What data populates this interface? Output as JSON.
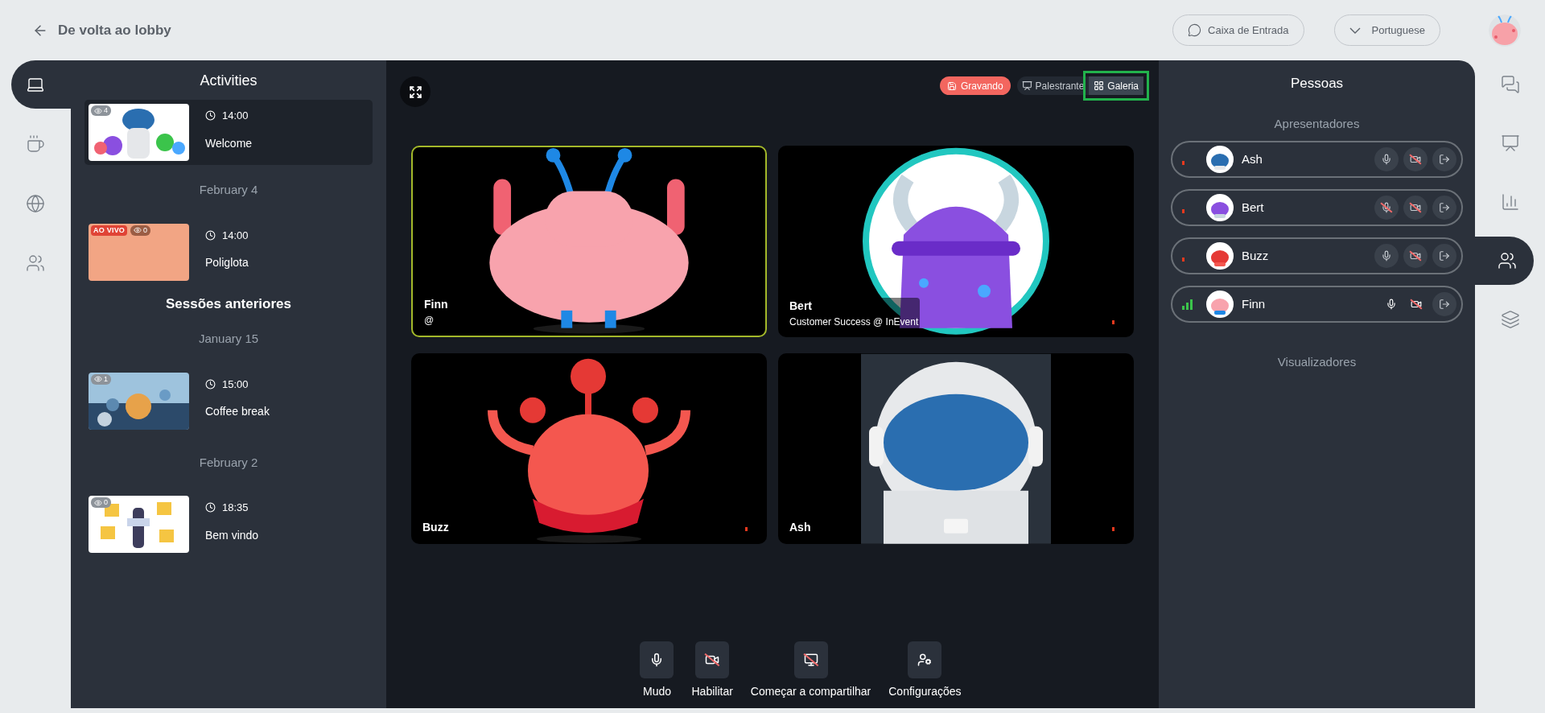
{
  "header": {
    "back_label": "De volta ao lobby",
    "inbox_label": "Caixa de Entrada",
    "language_label": "Portuguese"
  },
  "left_rail": [
    {
      "kind": "laptop",
      "selected": true
    },
    {
      "kind": "coffee",
      "selected": false
    },
    {
      "kind": "globe",
      "selected": false
    },
    {
      "kind": "people",
      "selected": false
    }
  ],
  "activities": {
    "title": "Activities",
    "entries": [
      {
        "kind": "session",
        "selected": true,
        "viewers": "4",
        "time": "14:00",
        "title": "Welcome"
      },
      {
        "kind": "date",
        "text": "February 4"
      },
      {
        "kind": "session",
        "selected": false,
        "live": "AO VIVO",
        "viewers": "0",
        "time": "14:00",
        "title": "Poliglota"
      },
      {
        "kind": "heading",
        "text": "Sessões anteriores"
      },
      {
        "kind": "date",
        "text": "January 15"
      },
      {
        "kind": "session",
        "selected": false,
        "viewers": "1",
        "time": "15:00",
        "title": "Coffee break"
      },
      {
        "kind": "date",
        "text": "February 2"
      },
      {
        "kind": "session",
        "selected": false,
        "viewers": "0",
        "time": "18:35",
        "title": "Bem vindo"
      }
    ]
  },
  "stage": {
    "recording": "Gravando",
    "views": [
      {
        "label": "Palestrante",
        "kind": "speaker",
        "selected": false
      },
      {
        "label": "Galeria",
        "kind": "gallery",
        "selected": true
      }
    ],
    "tiles": [
      {
        "name": "Finn",
        "subtitle": "@",
        "speaking": true
      },
      {
        "name": "Bert",
        "subtitle": "Customer Success @ InEvent",
        "speaking": false
      },
      {
        "name": "Buzz",
        "speaking": false
      },
      {
        "name": "Ash",
        "speaking": false
      }
    ],
    "controls": [
      {
        "kind": "mic",
        "label": "Mudo",
        "off": false
      },
      {
        "kind": "camera",
        "label": "Habilitar",
        "off": true
      },
      {
        "kind": "share",
        "label": "Começar a compartilhar",
        "off": true
      },
      {
        "kind": "settings",
        "label": "Configurações",
        "off": false
      }
    ]
  },
  "people": {
    "title": "Pessoas",
    "presenters_label": "Apresentadores",
    "presenters": [
      {
        "name": "Ash",
        "speaking": false,
        "mic_muted": false,
        "camera_off": true,
        "self": false
      },
      {
        "name": "Bert",
        "speaking": false,
        "mic_muted": true,
        "camera_off": true,
        "self": false
      },
      {
        "name": "Buzz",
        "speaking": false,
        "mic_muted": false,
        "camera_off": true,
        "self": false
      },
      {
        "name": "Finn",
        "speaking": true,
        "mic_muted": false,
        "camera_off": true,
        "self": true
      }
    ],
    "viewers_label": "Visualizadores"
  },
  "right_rail": [
    {
      "kind": "chat",
      "selected": false
    },
    {
      "kind": "presentation",
      "selected": false
    },
    {
      "kind": "chart",
      "selected": false
    },
    {
      "kind": "people",
      "selected": true
    },
    {
      "kind": "layers",
      "selected": false
    }
  ]
}
